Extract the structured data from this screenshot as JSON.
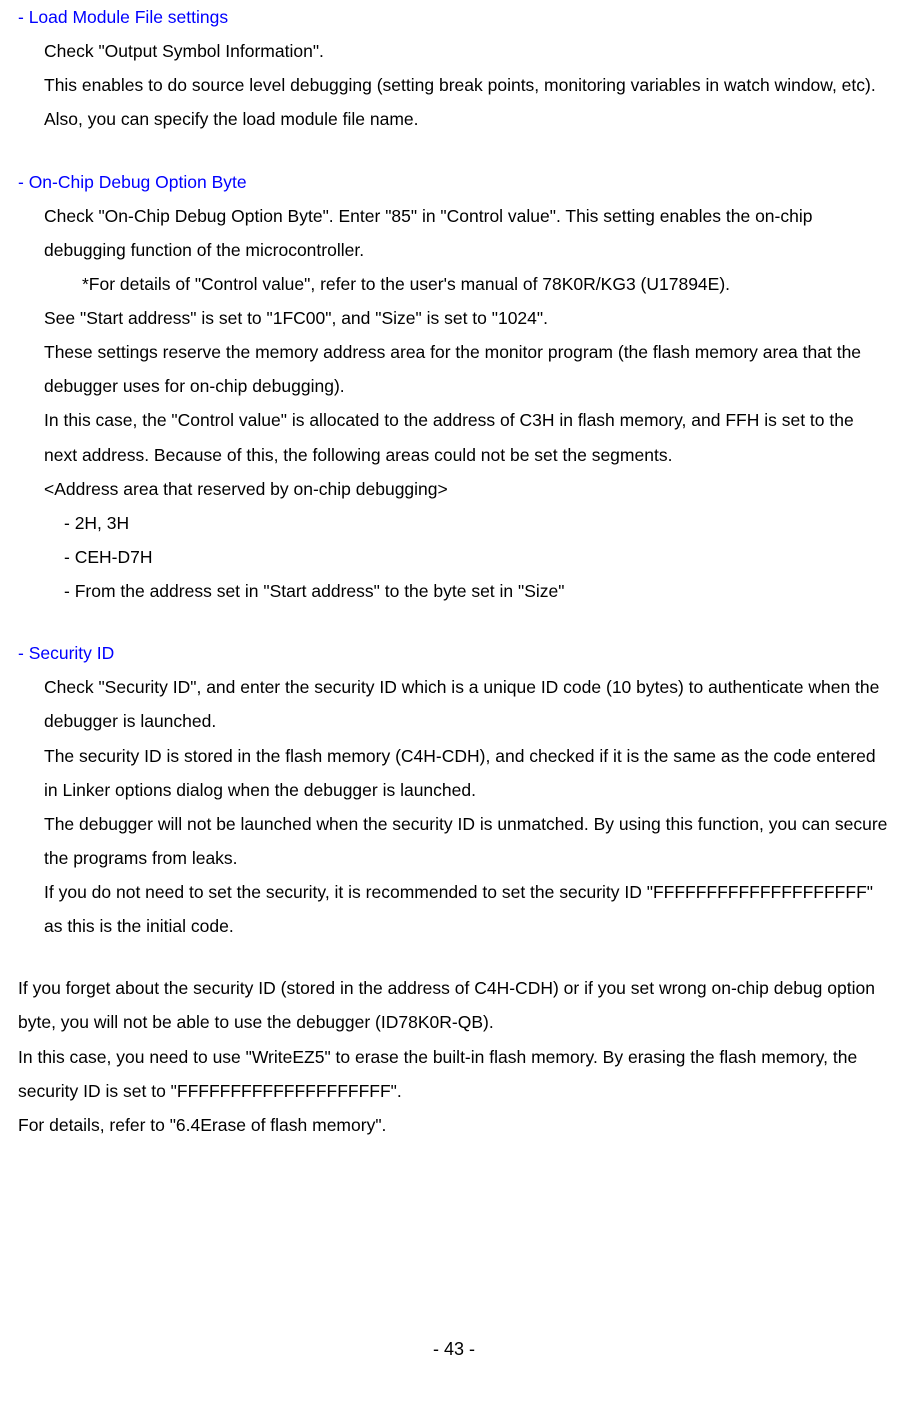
{
  "sections": {
    "loadModule": {
      "heading": "- Load Module File settings",
      "p1": "Check \"Output Symbol Information\".",
      "p2": "This enables to do source level debugging (setting break points, monitoring variables in watch window, etc).",
      "p3": "Also, you can specify the load module file name."
    },
    "onChip": {
      "heading": "- On-Chip Debug Option Byte",
      "p1": "Check \"On-Chip Debug Option Byte\". Enter \"85\" in \"Control value\". This setting enables the on-chip debugging function of the microcontroller.",
      "note": "*For details of \"Control value\", refer to the user's manual of 78K0R/KG3 (U17894E).",
      "p2": "See \"Start address\" is set to \"1FC00\", and \"Size\" is set to \"1024\".",
      "p3": "These settings reserve the memory address area for the monitor program (the flash memory area that the debugger uses for on-chip debugging).",
      "p4": "In this case, the \"Control value\" is allocated to the address of C3H in flash memory, and FFH is set to the next address. Because of this, the following areas could not be set the segments.",
      "p5": "<Address area that reserved by on-chip debugging>",
      "list1": "- 2H, 3H",
      "list2": "- CEH-D7H",
      "list3": "- From the address set in \"Start address\" to the byte set in \"Size\""
    },
    "security": {
      "heading": "- Security ID",
      "p1": "Check \"Security ID\", and enter the security ID which is a unique ID code (10 bytes) to authenticate when the debugger is launched.",
      "p2": "The security ID is stored in the flash memory (C4H-CDH), and checked if it is the same as the code entered in Linker options dialog when the debugger is launched.",
      "p3": "The debugger will not be launched when the security ID is unmatched. By using this function, you can secure the programs from leaks.",
      "p4": "If you do not need to set the security, it is recommended to set the security ID \"FFFFFFFFFFFFFFFFFFFF\" as this is the initial code."
    },
    "footer": {
      "p1": "If you forget about the security ID (stored in the address of C4H-CDH) or if you set wrong on-chip debug option byte, you will not be able to use the debugger (ID78K0R-QB).",
      "p2": "In this case, you need to use \"WriteEZ5\" to erase the built-in flash memory. By erasing the flash memory, the security ID is set to \"FFFFFFFFFFFFFFFFFFFF\".",
      "p3": "For details, refer to \"6.4Erase of flash memory\"."
    }
  },
  "pageNumber": "- 43 -"
}
